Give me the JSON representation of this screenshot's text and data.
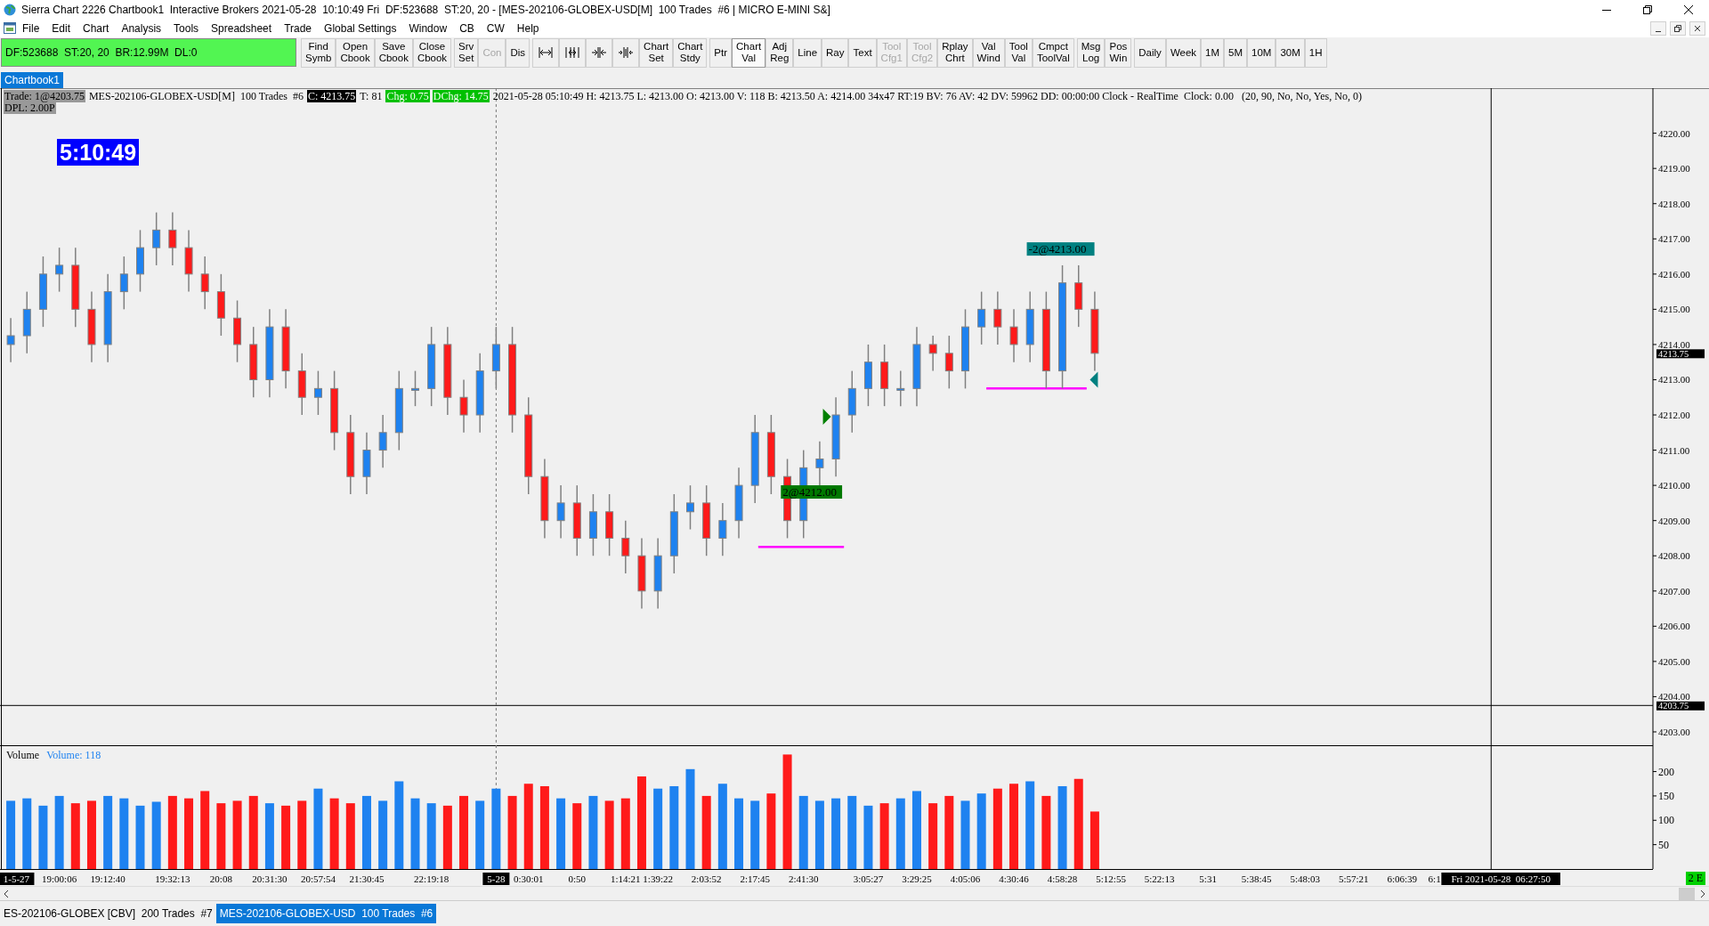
{
  "window": {
    "title": "Sierra Chart 2226 Chartbook1  Interactive Brokers 2021-05-28  10:10:49 Fri  DF:523688  ST:20, 20 - [MES-202106-GLOBEX-USD[M]  100 Trades  #6 | MICRO E-MINI S&]"
  },
  "menu": [
    "File",
    "Edit",
    "Chart",
    "Analysis",
    "Tools",
    "Spreadsheet",
    "Trade",
    "Global Settings",
    "Window",
    "CB",
    "CW",
    "Help"
  ],
  "status_box": "DF:523688  ST:20, 20  BR:12.99M  DL:0",
  "toolbar": [
    {
      "buttons": [
        {
          "kind": "text",
          "label": "Find Symb",
          "disabled": false,
          "selected": false
        },
        {
          "kind": "text",
          "label": "Open Cbook",
          "disabled": false,
          "selected": false
        },
        {
          "kind": "text",
          "label": "Save Cbook",
          "disabled": false,
          "selected": false
        },
        {
          "kind": "text",
          "label": "Close Cbook",
          "disabled": false,
          "selected": false
        }
      ]
    },
    {
      "buttons": [
        {
          "kind": "text",
          "label": "Srv Set",
          "disabled": false,
          "selected": false
        },
        {
          "kind": "text",
          "label": "Con",
          "disabled": true,
          "selected": false
        },
        {
          "kind": "text",
          "label": "Dis",
          "disabled": false,
          "selected": false
        }
      ]
    },
    {
      "buttons": [
        {
          "kind": "icon",
          "disabled": false,
          "selected": false
        },
        {
          "kind": "icon",
          "disabled": false,
          "selected": false
        },
        {
          "kind": "icon",
          "disabled": false,
          "selected": false
        },
        {
          "kind": "icon",
          "disabled": false,
          "selected": false
        },
        {
          "kind": "text",
          "label": "Chart Set",
          "disabled": false,
          "selected": false
        },
        {
          "kind": "text",
          "label": "Chart Stdy",
          "disabled": false,
          "selected": false
        }
      ]
    },
    {
      "buttons": [
        {
          "kind": "text",
          "label": "Ptr",
          "disabled": false,
          "selected": false
        },
        {
          "kind": "text",
          "label": "Chart Val",
          "disabled": false,
          "selected": true
        },
        {
          "kind": "text",
          "label": "Adj Reg",
          "disabled": false,
          "selected": false
        },
        {
          "kind": "text",
          "label": "Line",
          "disabled": false,
          "selected": false
        },
        {
          "kind": "text",
          "label": "Ray",
          "disabled": false,
          "selected": false
        },
        {
          "kind": "text",
          "label": "Text",
          "disabled": false,
          "selected": false
        },
        {
          "kind": "text",
          "label": "Tool Cfg1",
          "disabled": true,
          "selected": false
        },
        {
          "kind": "text",
          "label": "Tool Cfg2",
          "disabled": true,
          "selected": false
        },
        {
          "kind": "text",
          "label": "Rplay Chrt",
          "disabled": false,
          "selected": false
        },
        {
          "kind": "text",
          "label": "Val Wind",
          "disabled": false,
          "selected": false
        },
        {
          "kind": "text",
          "label": "Tool Val",
          "disabled": false,
          "selected": false
        },
        {
          "kind": "text",
          "label": "Cmpct ToolVal",
          "disabled": false,
          "selected": false
        }
      ]
    },
    {
      "buttons": [
        {
          "kind": "text",
          "label": "Msg Log",
          "disabled": false,
          "selected": false
        },
        {
          "kind": "text",
          "label": "Pos Win",
          "disabled": false,
          "selected": false
        }
      ]
    },
    {
      "buttons": [
        {
          "kind": "text",
          "label": "Daily",
          "disabled": false,
          "selected": false
        },
        {
          "kind": "text",
          "label": "Week",
          "disabled": false,
          "selected": false
        },
        {
          "kind": "text",
          "label": "1M",
          "disabled": false,
          "selected": false
        },
        {
          "kind": "text",
          "label": "5M",
          "disabled": false,
          "selected": false
        },
        {
          "kind": "text",
          "label": "10M",
          "disabled": false,
          "selected": false
        },
        {
          "kind": "text",
          "label": "30M",
          "disabled": false,
          "selected": false
        },
        {
          "kind": "text",
          "label": "1H",
          "disabled": false,
          "selected": false
        }
      ]
    }
  ],
  "chartbook_tabs": [
    {
      "label": "Chartbook1",
      "selected": true
    }
  ],
  "info_line": [
    {
      "kind": "gray",
      "text": "Trade: 1@4203.75"
    },
    {
      "kind": "plain",
      "text": "MES-202106-GLOBEX-USD[M]  100 Trades  #6"
    },
    {
      "kind": "black",
      "text": "C: 4213.75"
    },
    {
      "kind": "plain",
      "text": "T: 81"
    },
    {
      "kind": "green",
      "text": "Chg: 0.75"
    },
    {
      "kind": "green",
      "text": "DChg: 14.75"
    },
    {
      "kind": "plain",
      "text": "2021-05-28 05:10:49 H: 4213.75 L: 4213.00 O: 4213.00 V: 118 B: 4213.50 A: 4214.00 34x47 RT:19 BV: 76 AV: 42 DV: 59962 DD: 00:00:00 Clock - RealTime  Clock: 0.00   (20, 90, No, No, Yes, No, 0)"
    }
  ],
  "dpl": "DPL: 2.00P",
  "clock": "5:10:49",
  "price_chart": {
    "chart_data": {
      "type": "candlestick",
      "categories": [
        null,
        null,
        null,
        null,
        null,
        null,
        null,
        null,
        null,
        null,
        null,
        null,
        null,
        null,
        null,
        null,
        null,
        null,
        null,
        null,
        null,
        null,
        null,
        null,
        null,
        null,
        null,
        null,
        null,
        null,
        null,
        null,
        null,
        null,
        null,
        null,
        null,
        null,
        null,
        null,
        null,
        null,
        null,
        null,
        null,
        null,
        null,
        null,
        null,
        null,
        null,
        null,
        null,
        null,
        null,
        null,
        null,
        null,
        null,
        null,
        null,
        null,
        null,
        null,
        null,
        null,
        null,
        null,
        null,
        null,
        null,
        null,
        null,
        null,
        null,
        null,
        null,
        null,
        null,
        null,
        null,
        null,
        null,
        null,
        null,
        null,
        null,
        null,
        null,
        null,
        null,
        null,
        null,
        null,
        null,
        null,
        null,
        null,
        null,
        null,
        null,
        null
      ],
      "ohlc": [
        [
          4214.0,
          4214.75,
          4213.5,
          4214.25
        ],
        [
          4214.25,
          4215.5,
          4213.75,
          4215.0
        ],
        [
          4215.0,
          4216.5,
          4214.5,
          4216.0
        ],
        [
          4216.0,
          4216.75,
          4215.5,
          4216.25
        ],
        [
          4216.25,
          4216.75,
          4214.5,
          4215.0
        ],
        [
          4215.0,
          4215.5,
          4213.5,
          4214.0
        ],
        [
          4214.0,
          4216.0,
          4213.5,
          4215.5
        ],
        [
          4215.5,
          4216.5,
          4215.0,
          4216.0
        ],
        [
          4216.0,
          4217.25,
          4215.5,
          4216.75
        ],
        [
          4216.75,
          4217.75,
          4216.25,
          4217.25
        ],
        [
          4217.25,
          4217.75,
          4216.25,
          4216.75
        ],
        [
          4216.75,
          4217.25,
          4215.5,
          4216.0
        ],
        [
          4216.0,
          4216.5,
          4215.0,
          4215.5
        ],
        [
          4215.5,
          4216.0,
          4214.25,
          4214.75
        ],
        [
          4214.75,
          4215.25,
          4213.5,
          4214.0
        ],
        [
          4214.0,
          4214.5,
          4212.5,
          4213.0
        ],
        [
          4213.0,
          4215.0,
          4212.5,
          4214.5
        ],
        [
          4214.5,
          4215.0,
          4212.75,
          4213.25
        ],
        [
          4213.25,
          4213.75,
          4212.0,
          4212.5
        ],
        [
          4212.5,
          4213.25,
          4212.0,
          4212.75
        ],
        [
          4212.75,
          4213.25,
          4211.0,
          4211.5
        ],
        [
          4211.5,
          4212.0,
          4209.75,
          4210.25
        ],
        [
          4210.25,
          4211.5,
          4209.75,
          4211.0
        ],
        [
          4211.0,
          4212.0,
          4210.5,
          4211.5
        ],
        [
          4211.5,
          4213.25,
          4211.0,
          4212.75
        ],
        [
          4212.75,
          4213.25,
          4212.25,
          4212.75
        ],
        [
          4212.75,
          4214.5,
          4212.25,
          4214.0
        ],
        [
          4214.0,
          4214.5,
          4212.0,
          4212.5
        ],
        [
          4212.5,
          4213.0,
          4211.5,
          4212.0
        ],
        [
          4212.0,
          4213.75,
          4211.5,
          4213.25
        ],
        [
          4213.25,
          4214.5,
          4212.75,
          4214.0
        ],
        [
          4214.0,
          4214.5,
          4211.5,
          4212.0
        ],
        [
          4212.0,
          4212.5,
          4209.75,
          4210.25
        ],
        [
          4210.25,
          4210.75,
          4208.5,
          4209.0
        ],
        [
          4209.0,
          4210.0,
          4208.5,
          4209.5
        ],
        [
          4209.5,
          4210.0,
          4208.0,
          4208.5
        ],
        [
          4208.5,
          4209.75,
          4208.0,
          4209.25
        ],
        [
          4209.25,
          4209.75,
          4208.0,
          4208.5
        ],
        [
          4208.5,
          4209.0,
          4207.5,
          4208.0
        ],
        [
          4208.0,
          4208.5,
          4206.5,
          4207.0
        ],
        [
          4207.0,
          4208.5,
          4206.5,
          4208.0
        ],
        [
          4208.0,
          4209.75,
          4207.5,
          4209.25
        ],
        [
          4209.25,
          4210.0,
          4208.75,
          4209.5
        ],
        [
          4209.5,
          4210.0,
          4208.0,
          4208.5
        ],
        [
          4208.5,
          4209.5,
          4208.0,
          4209.0
        ],
        [
          4209.0,
          4210.5,
          4208.5,
          4210.0
        ],
        [
          4210.0,
          4212.0,
          4209.5,
          4211.5
        ],
        [
          4211.5,
          4212.0,
          4209.75,
          4210.25
        ],
        [
          4210.25,
          4210.75,
          4208.5,
          4209.0
        ],
        [
          4209.0,
          4211.0,
          4208.5,
          4210.5
        ],
        [
          4210.5,
          4211.25,
          4210.0,
          4210.75
        ],
        [
          4210.75,
          4212.5,
          4210.25,
          4212.0
        ],
        [
          4212.0,
          4213.25,
          4211.5,
          4212.75
        ],
        [
          4212.75,
          4214.0,
          4212.25,
          4213.5
        ],
        [
          4213.5,
          4214.0,
          4212.25,
          4212.75
        ],
        [
          4212.75,
          4213.25,
          4212.25,
          4212.75
        ],
        [
          4212.75,
          4214.5,
          4212.25,
          4214.0
        ],
        [
          4214.0,
          4214.25,
          4213.25,
          4213.75
        ],
        [
          4213.75,
          4214.25,
          4212.75,
          4213.25
        ],
        [
          4213.25,
          4215.0,
          4212.75,
          4214.5
        ],
        [
          4214.5,
          4215.5,
          4214.0,
          4215.0
        ],
        [
          4215.0,
          4215.5,
          4214.0,
          4214.5
        ],
        [
          4214.5,
          4215.0,
          4213.5,
          4214.0
        ],
        [
          4214.0,
          4215.5,
          4213.5,
          4215.0
        ],
        [
          4215.0,
          4215.5,
          4212.75,
          4213.25
        ],
        [
          4213.25,
          4216.25,
          4212.75,
          4215.75
        ],
        [
          4215.75,
          4216.25,
          4214.5,
          4215.0
        ],
        [
          4215.0,
          4215.5,
          4213.25,
          4213.75
        ],
        null,
        null,
        null,
        null,
        null,
        null,
        null,
        null,
        null,
        null,
        null,
        null,
        null,
        null,
        null,
        null,
        null,
        null,
        null,
        null,
        null,
        null,
        null,
        null,
        null,
        null,
        null,
        null,
        null,
        null,
        null,
        null,
        null,
        null
      ],
      "ylim": [
        4202.62,
        4221.28
      ],
      "yticks": [
        {
          "value": 4220,
          "label": "4220.00"
        },
        {
          "value": 4219,
          "label": "4219.00"
        },
        {
          "value": 4218,
          "label": "4218.00"
        },
        {
          "value": 4217,
          "label": "4217.00"
        },
        {
          "value": 4216,
          "label": "4216.00"
        },
        {
          "value": 4215,
          "label": "4215.00"
        },
        {
          "value": 4214,
          "label": "4214.00"
        },
        {
          "value": 4213,
          "label": "4213.00"
        },
        {
          "value": 4212,
          "label": "4212.00"
        },
        {
          "value": 4211,
          "label": "4211.00"
        },
        {
          "value": 4210,
          "label": "4210.00"
        },
        {
          "value": 4209,
          "label": "4209.00"
        },
        {
          "value": 4208,
          "label": "4208.00"
        },
        {
          "value": 4207,
          "label": "4207.00"
        },
        {
          "value": 4206,
          "label": "4206.00"
        },
        {
          "value": 4205,
          "label": "4205.00"
        },
        {
          "value": 4204,
          "label": "4204.00"
        },
        {
          "value": 4203,
          "label": "4203.00"
        }
      ],
      "annotations": [
        "2@4212.00",
        "-2@4213.00",
        "4213.75",
        "4203.75"
      ]
    }
  },
  "volume_panel": {
    "title": "Volume",
    "readout": "Volume: 118",
    "chart_data": {
      "type": "bar",
      "categories": [
        null,
        null,
        null,
        "19:00:06",
        null,
        null,
        "19:12:40",
        null,
        null,
        null,
        "19:32:13",
        null,
        null,
        "20:08",
        null,
        null,
        "20:31:30",
        null,
        null,
        "20:57:54",
        null,
        null,
        "21:30:45",
        null,
        null,
        null,
        "22:19:18",
        null,
        null,
        null,
        null,
        null,
        "0:30:01",
        null,
        null,
        "0:50",
        null,
        null,
        "1:14:21",
        null,
        "1:39:22",
        null,
        null,
        "2:03:52",
        null,
        null,
        "2:17:45",
        null,
        null,
        "2:41:30",
        null,
        null,
        null,
        "3:05:27",
        null,
        null,
        "3:29:25",
        null,
        null,
        "4:05:06",
        null,
        null,
        "4:30:46",
        null,
        null,
        "4:58:28",
        null,
        null,
        "5:12:55",
        null,
        null,
        "5:22:13",
        null,
        null,
        "5:31",
        null,
        null,
        "5:38:45",
        null,
        null,
        "5:48:03",
        null,
        null,
        "5:57:21",
        null,
        null,
        "6:06:39",
        null,
        "6:1",
        null,
        null,
        null,
        null,
        null,
        null,
        null,
        null,
        null,
        null,
        null,
        null,
        null
      ],
      "series": [
        {
          "color": "#1e82f0",
          "values": [
            140,
            145,
            130,
            150,
            null,
            null,
            150,
            145,
            130,
            138,
            null,
            null,
            null,
            null,
            null,
            null,
            135,
            null,
            null,
            165,
            null,
            null,
            150,
            140,
            180,
            145,
            135,
            null,
            null,
            140,
            165,
            null,
            null,
            null,
            145,
            null,
            150,
            null,
            null,
            null,
            165,
            170,
            205,
            null,
            175,
            145,
            140,
            null,
            null,
            150,
            140,
            145,
            150,
            130,
            null,
            145,
            160,
            null,
            null,
            140,
            155,
            null,
            null,
            180,
            null,
            170,
            null,
            null,
            null,
            null,
            null,
            null,
            null,
            null,
            null,
            null,
            null,
            null,
            null,
            null,
            null,
            null,
            null,
            null,
            null,
            null,
            null,
            null,
            null,
            null,
            null,
            null,
            null,
            null,
            null,
            null,
            null,
            null,
            null,
            null,
            null,
            null
          ]
        },
        {
          "color": "#ff1a1a",
          "values": [
            null,
            null,
            null,
            null,
            135,
            140,
            null,
            null,
            null,
            null,
            150,
            145,
            160,
            135,
            140,
            150,
            null,
            130,
            140,
            null,
            145,
            135,
            null,
            null,
            null,
            null,
            null,
            130,
            150,
            null,
            null,
            150,
            175,
            170,
            null,
            135,
            null,
            140,
            145,
            190,
            null,
            null,
            null,
            150,
            null,
            null,
            null,
            155,
            235,
            null,
            null,
            null,
            null,
            null,
            135,
            null,
            null,
            135,
            150,
            null,
            null,
            165,
            175,
            null,
            150,
            null,
            185,
            118,
            null,
            null,
            null,
            null,
            null,
            null,
            null,
            null,
            null,
            null,
            null,
            null,
            null,
            null,
            null,
            null,
            null,
            null,
            null,
            null,
            null,
            null,
            null,
            null,
            null,
            null,
            null,
            null,
            null,
            null,
            null,
            null,
            null,
            null
          ]
        }
      ],
      "ylim": [
        0,
        254
      ],
      "yticks": [
        50,
        100,
        150,
        200
      ],
      "annotations": [
        "1-5-27",
        "5-28",
        "Fri 2021-05-28  06:27:50"
      ]
    }
  },
  "status_badge": "2 E",
  "bottom_tabs": [
    {
      "label": "ES-202106-GLOBEX [CBV]  200 Trades  #7",
      "selected": false
    },
    {
      "label": "MES-202106-GLOBEX-USD  100 Trades  #6",
      "selected": true
    }
  ]
}
